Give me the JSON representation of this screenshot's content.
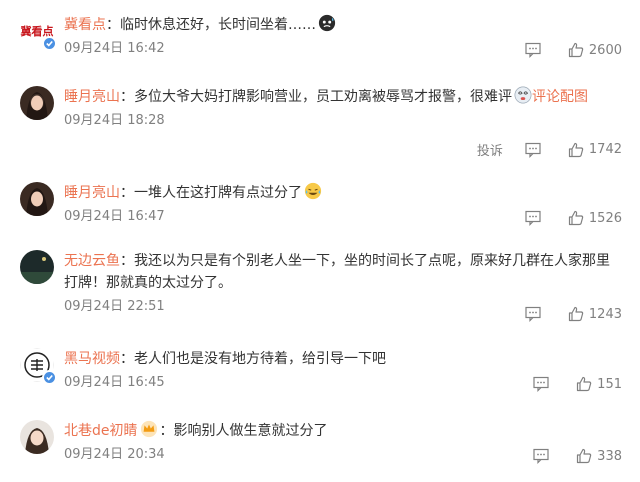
{
  "comments": [
    {
      "username": "冀看点",
      "text": "临时休息还好，长时间坐着……",
      "emoji": "sweat-emoji",
      "time": "09月24日 16:42",
      "likes": "2600",
      "verified": true,
      "avatar_label": "冀看点"
    },
    {
      "username": "睡月亮山",
      "text": "多位大爷大妈打牌影响营业，员工劝离被辱骂才报警，很难评",
      "emoji": "dizzy-emoji",
      "link": "评论配图",
      "time": "09月24日 18:28",
      "report": "投诉",
      "likes": "1742"
    },
    {
      "username": "睡月亮山",
      "text": "一堆人在这打牌有点过分了",
      "emoji": "laugh-cry-emoji",
      "time": "09月24日 16:47",
      "likes": "1526"
    },
    {
      "username": "无边云鱼",
      "text": "我还以为只是有个别老人坐一下，坐的时间长了点呢，原来好几群在人家那里打牌！那就真的太过分了。",
      "time": "09月24日 22:51",
      "likes": "1243"
    },
    {
      "username": "黑马视频",
      "text": "老人们也是没有地方待着，给引导一下吧",
      "time": "09月24日 16:45",
      "likes": "151",
      "verified": true
    },
    {
      "username": "北巷de初睛",
      "text": "影响别人做生意就过分了",
      "badge": "crown-badge",
      "time": "09月24日 20:34",
      "likes": "338"
    }
  ],
  "colors": {
    "username": "#eb7350",
    "meta": "#808080",
    "verified": "#4a90e2"
  }
}
